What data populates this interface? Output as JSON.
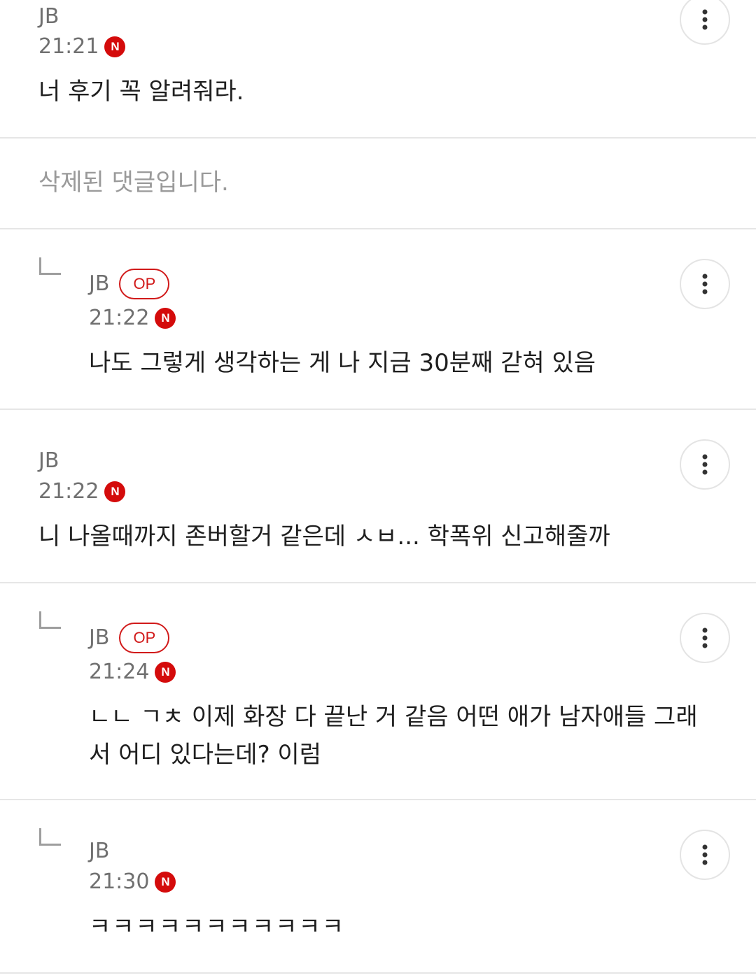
{
  "comments": [
    {
      "author": "JB",
      "time": "21:21",
      "new_badge": "N",
      "text": "너 후기 꼭 알려줘라."
    },
    {
      "deleted_text": "삭제된 댓글입니다."
    },
    {
      "author": "JB",
      "op_badge": "OP",
      "time": "21:22",
      "new_badge": "N",
      "text": "나도 그렇게 생각하는 게 나 지금 30분째 갇혀 있음"
    },
    {
      "author": "JB",
      "time": "21:22",
      "new_badge": "N",
      "text": "니 나올때까지 존버할거 같은데 ㅅㅂ... 학폭위 신고해줄까"
    },
    {
      "author": "JB",
      "op_badge": "OP",
      "time": "21:24",
      "new_badge": "N",
      "text_line1": "ㄴㄴ ㄱㅊ 이제 화장 다 끝난 거 같음 어떤 애가 남자애들 그래",
      "text_line2": "서 어디 있다는데? 이럼"
    },
    {
      "author": "JB",
      "time": "21:30",
      "new_badge": "N",
      "text": "ㅋㅋㅋㅋㅋㅋㅋㅋㅋㅋㅋ"
    }
  ],
  "icons": {
    "more": "more-vertical-icon",
    "reply": "reply-indent-icon"
  },
  "colors": {
    "accent_red": "#d40b0b",
    "meta_gray": "#707070",
    "deleted_gray": "#9a9a9a",
    "divider": "#e6e6e6"
  }
}
